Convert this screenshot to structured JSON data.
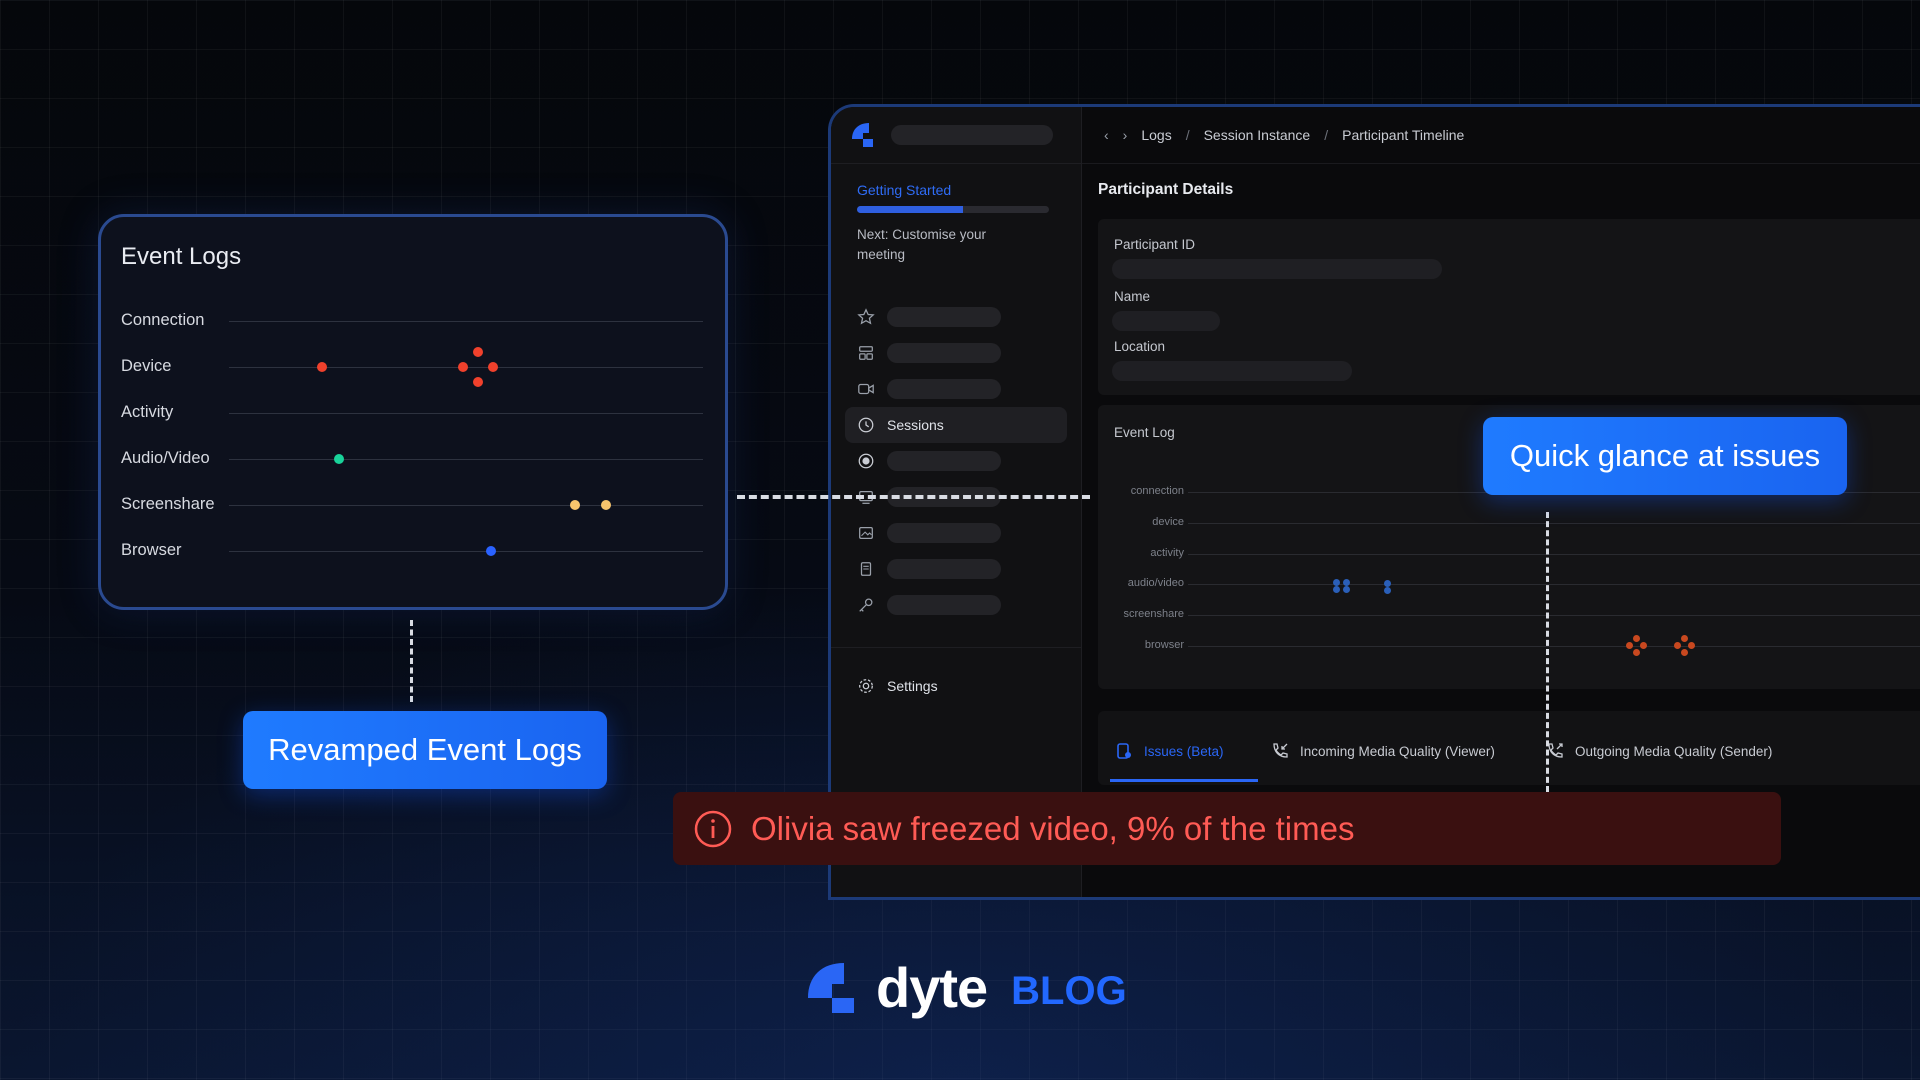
{
  "app": {
    "breadcrumb": [
      "Logs",
      "Session Instance",
      "Participant Timeline"
    ],
    "getting_started": {
      "title": "Getting Started",
      "progress": 0.55,
      "next": "Next: Customise your meeting"
    },
    "nav": {
      "sessions": "Sessions",
      "settings": "Settings"
    },
    "details_title": "Participant Details",
    "fields": [
      "Participant ID",
      "Name",
      "Location"
    ],
    "event_log": {
      "title": "Event Log",
      "rows": [
        "connection",
        "device",
        "activity",
        "audio/video",
        "screenshare",
        "browser"
      ]
    },
    "tabs": [
      "Issues (Beta)",
      "Incoming Media Quality (Viewer)",
      "Outgoing Media Quality (Sender)"
    ]
  },
  "event_logs_card": {
    "title": "Event Logs",
    "rows": [
      "Connection",
      "Device",
      "Activity",
      "Audio/Video",
      "Screenshare",
      "Browser"
    ]
  },
  "callouts": {
    "left": "Revamped Event Logs",
    "right": "Quick glance at issues"
  },
  "alert": {
    "text": "Olivia saw freezed video, 9% of the times",
    "icon": "info-circle-icon"
  },
  "brand": {
    "name": "dyte",
    "blog": "BLOG"
  },
  "colors": {
    "accent": "#1f7bff",
    "alert_bg": "#3a1010",
    "alert_text": "#ff5b55",
    "device_dot": "#f0412c",
    "av_dot": "#19d39a",
    "screenshare_dot": "#f7c46c",
    "browser_dot": "#2a62ff"
  }
}
